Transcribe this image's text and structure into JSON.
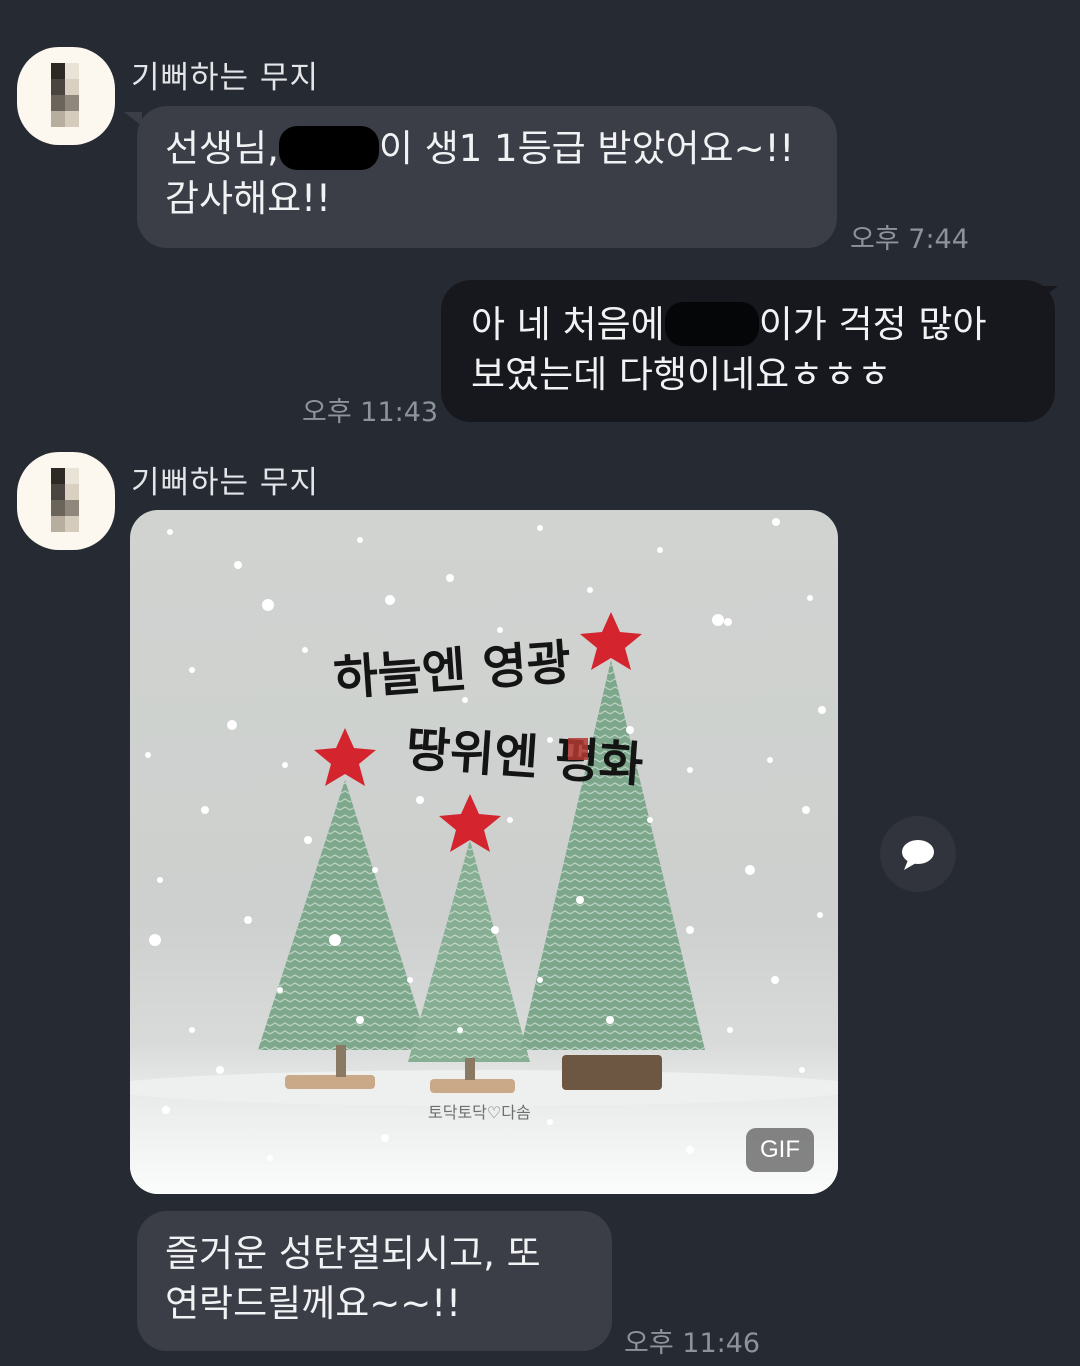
{
  "messages": [
    {
      "sender": "기뻐하는 무지",
      "line1_before": "선생님,",
      "line1_after": "이 생1 1등급 받았어요~!!",
      "line2": "감사해요!!",
      "time": "오후 7:44"
    },
    {
      "line1_before": "아 네 처음에",
      "line1_after": "이가 걱정 많아",
      "line2": "보였는데 다행이네요ㅎㅎㅎ",
      "time": "오후 11:43"
    },
    {
      "sender": "기뻐하는 무지",
      "gif": {
        "calligraphy_1": "하늘엔 영광",
        "calligraphy_2": "땅위엔 평화",
        "signature": "토닥토닥♡다솜",
        "badge": "GIF"
      }
    },
    {
      "line1": "즐거운 성탄절되시고, 또",
      "line2": "연락드릴께요~~!!",
      "time": "오후 11:46"
    }
  ],
  "icons": {
    "share": "speech-bubble-icon"
  },
  "colors": {
    "background": "#262a33",
    "incoming_bubble": "#3b3e47",
    "outgoing_bubble": "#16181d",
    "timestamp": "#8e9299"
  }
}
